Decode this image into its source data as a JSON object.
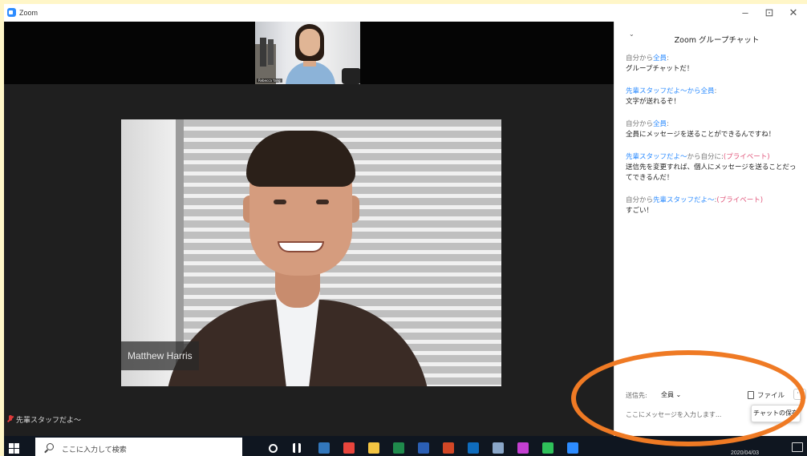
{
  "window": {
    "app_title": "Zoom",
    "minimize": "–",
    "restore": "⊡",
    "close": "✕"
  },
  "video": {
    "thumbnail_name": "Rebecca Yang",
    "main_participant_name": "Matthew Harris",
    "active_speaker": "先輩スタッフだよ～"
  },
  "chat": {
    "title": "Zoom グループチャット",
    "collapse_icon": "chevron-down-icon",
    "messages": [
      {
        "from": "自分から",
        "to": "全員",
        "private": "",
        "text": "グループチャットだ！"
      },
      {
        "from": "先輩スタッフだよ～から",
        "to": "全員",
        "private": "",
        "text": "文字が送れるぞ！"
      },
      {
        "from": "自分から",
        "to": "全員",
        "private": "",
        "text": "全員にメッセージを送ることができるんですね！"
      },
      {
        "from": "先輩スタッフだよ～",
        "to": "自分に",
        "private": "(プライベート)",
        "text": "送信先を変更すれば、個人にメッセージを送ることだってできるんだ！"
      },
      {
        "from": "自分から",
        "to": "先輩スタッフだよ～",
        "private": "(プライベート)",
        "text": "すごい！"
      }
    ],
    "send_to_label": "送信先:",
    "recipient": "全員 ⌄",
    "file_button": "ファイル",
    "more_button": "···",
    "input_placeholder": "ここにメッセージを入力します...",
    "save_chat_popup": "チャットの保存",
    "highlight_color": "#ef7a24"
  },
  "taskbar": {
    "search_placeholder": "ここに入力して検索",
    "date": "2020/04/03",
    "app_icons": [
      {
        "name": "edge-icon",
        "color": "#3277bc"
      },
      {
        "name": "chrome-icon",
        "color": "#e8453c"
      },
      {
        "name": "file-explorer-icon",
        "color": "#f4c542"
      },
      {
        "name": "excel-icon",
        "color": "#1f8a4c"
      },
      {
        "name": "word-icon",
        "color": "#2b5fb4"
      },
      {
        "name": "powerpoint-icon",
        "color": "#d24726"
      },
      {
        "name": "outlook-icon",
        "color": "#0f6cbd"
      },
      {
        "name": "photos-icon",
        "color": "#8aa7c9"
      },
      {
        "name": "maps-icon",
        "color": "#c33fd1"
      },
      {
        "name": "line-icon",
        "color": "#2fc15a"
      },
      {
        "name": "zoom-icon",
        "color": "#2d8cff"
      }
    ]
  }
}
